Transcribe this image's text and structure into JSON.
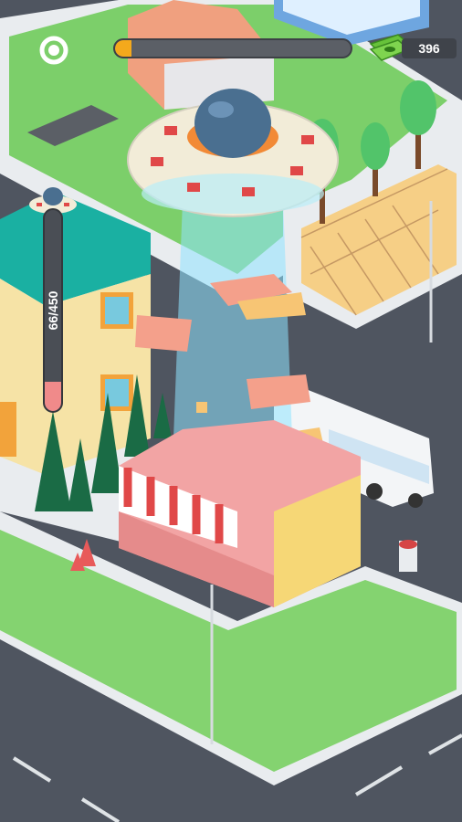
{
  "hud": {
    "money": "396",
    "progress_fraction": 0.07,
    "capacity_label": "66/450",
    "capacity_fraction": 0.147
  },
  "icons": {
    "settings": "gear-icon",
    "money": "cash-stack-icon",
    "ufo_mini": "ufo-icon"
  },
  "colors": {
    "progress": "#f4a91c",
    "capacity": "#f08a8a",
    "grass": "#7ccf6a",
    "road": "#4f5560"
  }
}
